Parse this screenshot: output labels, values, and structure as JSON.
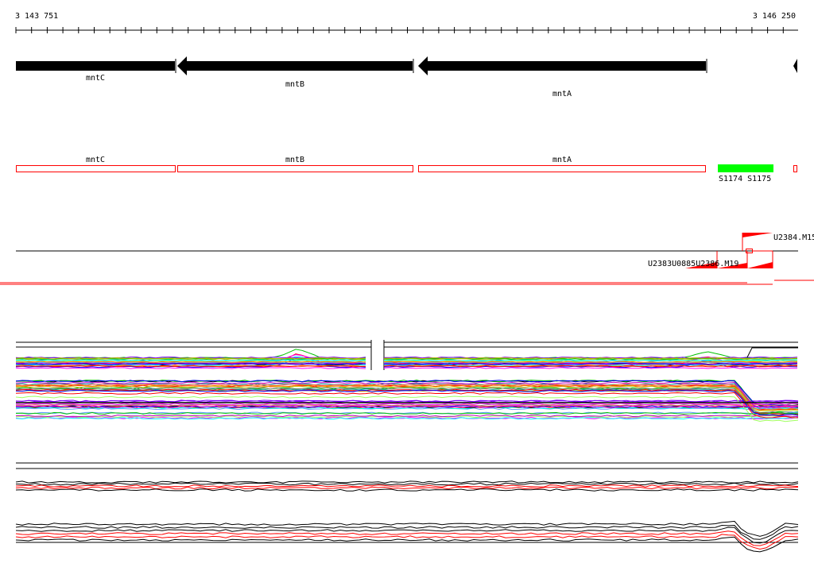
{
  "coords": {
    "start": "3 143 751",
    "end": "3 146 250"
  },
  "genes": [
    {
      "name": "mntC",
      "strand": "+"
    },
    {
      "name": "mntB",
      "strand": "-"
    },
    {
      "name": "mntA",
      "strand": "-"
    }
  ],
  "gene_annotations": [
    {
      "name": "mntC"
    },
    {
      "name": "mntB"
    },
    {
      "name": "mntA"
    }
  ],
  "features": {
    "labels": "S1174 S1175",
    "color": "#00ff00"
  },
  "clusters": {
    "top": "U2384.M15",
    "bottom": "U2383U0885U2386.M19"
  },
  "colors": {
    "gene": "#000000",
    "annotation_border": "#ff0000",
    "accent": "#ff0000"
  }
}
